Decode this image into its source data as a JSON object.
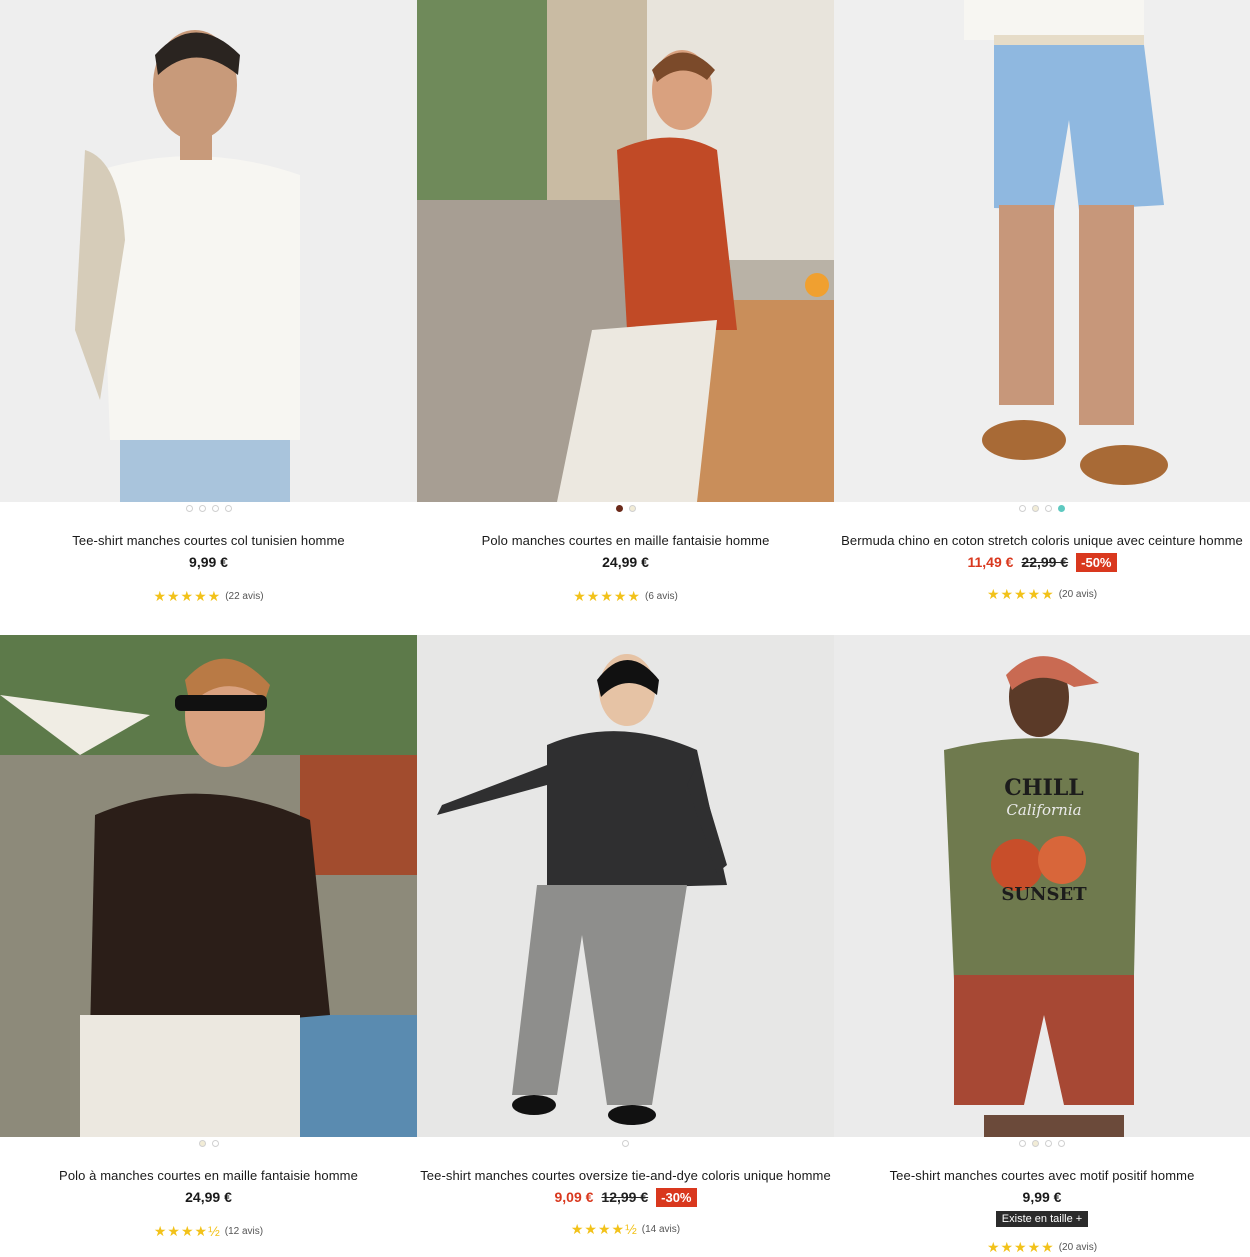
{
  "products": [
    {
      "title": "Tee-shirt manches courtes col tunisien homme",
      "price": "9,99 €",
      "rating_stars": "★★★★★",
      "reviews": "(22 avis)",
      "dot_colors": [
        "#ffffff",
        "#f4f4f4",
        "#ffffff",
        "#ffffff"
      ],
      "image": "man-white-tee-photo"
    },
    {
      "title": "Polo manches courtes en maille fantaisie homme",
      "price": "24,99 €",
      "rating_stars": "★★★★★",
      "reviews": "(6 avis)",
      "dot_colors": [
        "#6b2a1a",
        "#f2ecd6"
      ],
      "image": "man-red-polo-terrace-photo"
    },
    {
      "title": "Bermuda chino en coton stretch coloris unique avec ceinture homme",
      "sale_price": "11,49 €",
      "old_price": "22,99 €",
      "discount": "-50%",
      "rating_stars": "★★★★★",
      "reviews": "(20 avis)",
      "dot_colors": [
        "#ffffff",
        "#f2ecd6",
        "#ffffff",
        "#5ec9c0"
      ],
      "image": "blue-bermuda-shorts-photo"
    },
    {
      "title": "Polo à manches courtes en maille fantaisie homme",
      "price": "24,99 €",
      "rating_stars": "★★★★½",
      "reviews": "(12 avis)",
      "dot_colors": [
        "#f2ecd6",
        "#ffffff"
      ],
      "image": "man-black-polo-poolside-photo"
    },
    {
      "title": "Tee-shirt manches courtes oversize tie-and-dye coloris unique homme",
      "sale_price": "9,09 €",
      "old_price": "12,99 €",
      "discount": "-30%",
      "rating_stars": "★★★★½",
      "reviews": "(14 avis)",
      "dot_colors": [
        "#ffffff"
      ],
      "image": "man-leather-jacket-photo"
    },
    {
      "title": "Tee-shirt manches courtes avec motif positif homme",
      "price": "9,99 €",
      "size_badge": "Existe en taille +",
      "rating_stars": "★★★★★",
      "reviews": "(20 avis)",
      "dot_colors": [
        "#ffffff",
        "#f2ecd6",
        "#ffffff",
        "#ffffff"
      ],
      "image": "man-green-tee-cap-photo",
      "tee_print": {
        "line1": "CHILL",
        "line2": "California",
        "line3": "SUNSET"
      }
    }
  ]
}
